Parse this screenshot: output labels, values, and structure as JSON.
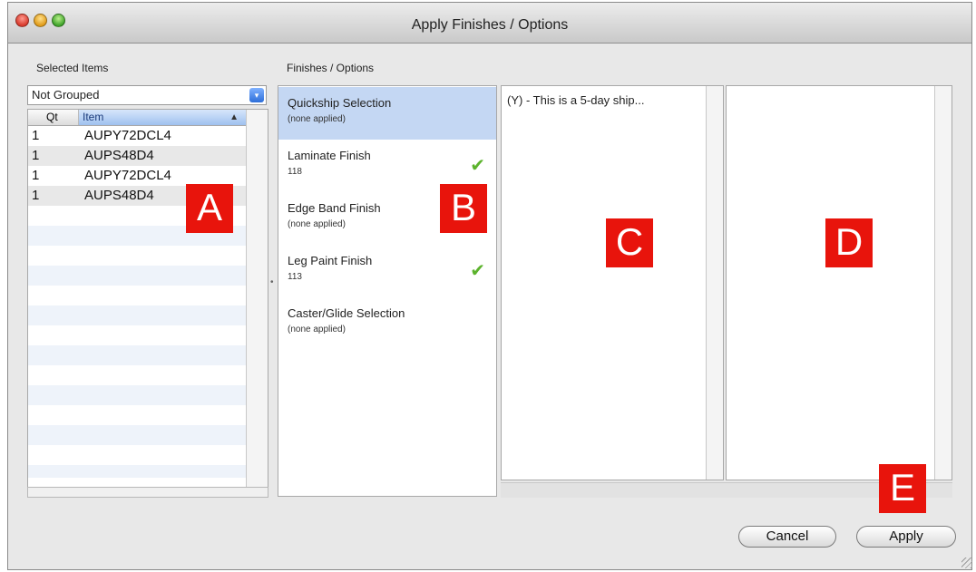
{
  "window": {
    "title": "Apply Finishes / Options"
  },
  "selected_items": {
    "label": "Selected Items",
    "grouping": "Not Grouped",
    "columns": {
      "qt": "Qt",
      "item": "Item"
    },
    "rows": [
      {
        "qt": "1",
        "item": "AUPY72DCL4"
      },
      {
        "qt": "1",
        "item": "AUPS48D4"
      },
      {
        "qt": "1",
        "item": "AUPY72DCL4"
      },
      {
        "qt": "1",
        "item": "AUPS48D4"
      }
    ]
  },
  "finishes": {
    "label": "Finishes / Options",
    "options": [
      {
        "name": "Quickship Selection",
        "value": "(none applied)",
        "checked": false,
        "selected": true
      },
      {
        "name": "Laminate Finish",
        "value": "118",
        "checked": true,
        "selected": false
      },
      {
        "name": "Edge Band Finish",
        "value": "(none applied)",
        "checked": false,
        "selected": false
      },
      {
        "name": "Leg Paint Finish",
        "value": "113",
        "checked": true,
        "selected": false
      },
      {
        "name": "Caster/Glide Selection",
        "value": "(none applied)",
        "checked": false,
        "selected": false
      }
    ]
  },
  "choices": {
    "text": "(Y) - This is a 5-day ship..."
  },
  "badges": {
    "a": "A",
    "b": "B",
    "c": "C",
    "d": "D",
    "e": "E"
  },
  "buttons": {
    "cancel": "Cancel",
    "apply": "Apply"
  },
  "colors": {
    "badge": "#e8140c",
    "selection": "#c4d7f3",
    "check": "#5cb32d"
  }
}
